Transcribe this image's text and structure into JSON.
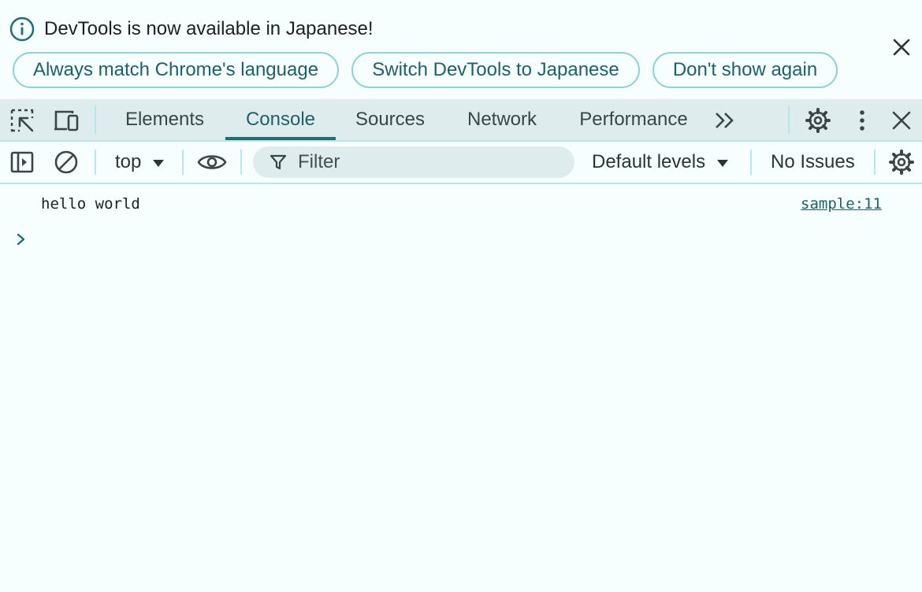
{
  "banner": {
    "message": "DevTools is now available in Japanese!",
    "buttons": [
      "Always match Chrome's language",
      "Switch DevTools to Japanese",
      "Don't show again"
    ],
    "icon": "info-icon",
    "close_icon": "close-icon"
  },
  "tabbar": {
    "tabs": [
      "Elements",
      "Console",
      "Sources",
      "Network",
      "Performance"
    ],
    "active_tab": "Console",
    "icons": [
      "inspect-element-icon",
      "device-toolbar-icon",
      "more-tabs-icon",
      "settings-gear-icon",
      "more-options-kebab-icon",
      "close-icon"
    ]
  },
  "toolbar": {
    "context": "top",
    "filter_placeholder": "Filter",
    "levels": "Default levels",
    "issues": "No Issues",
    "icons": [
      "sidebar-toggle-icon",
      "clear-console-icon",
      "eye-icon",
      "filter-icon",
      "console-settings-gear-icon"
    ]
  },
  "console": {
    "messages": [
      {
        "text": "hello world",
        "source": "sample:11"
      }
    ]
  },
  "colors": {
    "background": "#f6fefe",
    "tabbar_bg": "#dfeced",
    "accent": "#1f6e76",
    "border": "#b8e6ea",
    "pill_border": "#8fd2d6"
  }
}
